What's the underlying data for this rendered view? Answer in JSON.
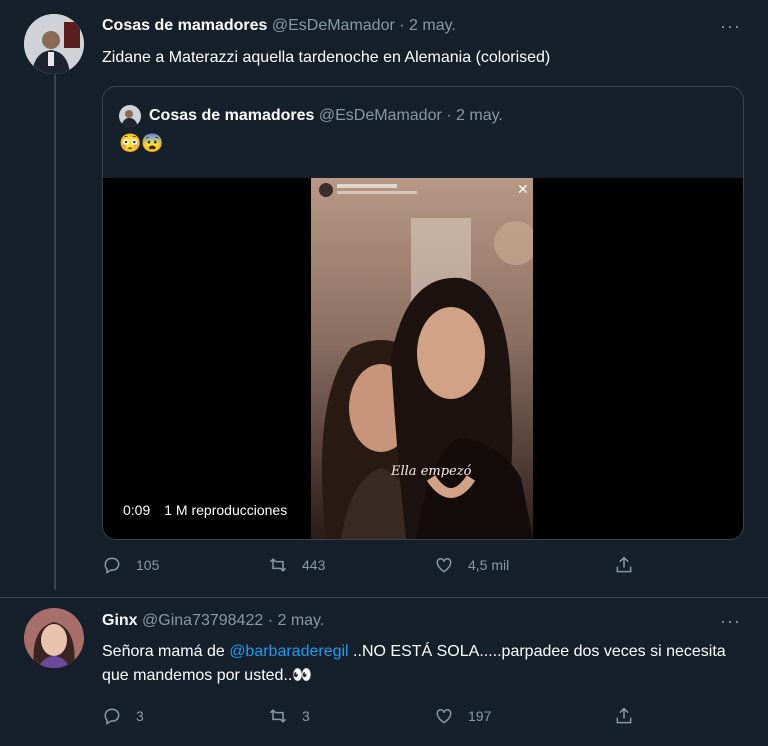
{
  "tweet1": {
    "display_name": "Cosas de mamadores",
    "handle": "@EsDeMamador",
    "date": "· 2 may.",
    "text": "Zidane a Materazzi aquella tardenoche en Alemania (colorised)",
    "more": "···",
    "quote": {
      "display_name": "Cosas de mamadores",
      "handle": "@EsDeMamador",
      "date": "· 2 may.",
      "text": "😳😨",
      "video": {
        "duration": "0:09",
        "views": "1 M reproducciones",
        "story_caption": "Ella empezó"
      }
    },
    "actions": {
      "replies": "105",
      "retweets": "443",
      "likes": "4,5 mil"
    }
  },
  "tweet2": {
    "display_name": "Ginx",
    "handle": "@Gina73798422",
    "date": "· 2 may.",
    "text_before": "Señora mamá de ",
    "mention": "@barbaraderegil",
    "text_after": " ..NO ESTÁ SOLA.....parpadee dos veces si necesita que mandemos por usted..👀",
    "more": "···",
    "actions": {
      "replies": "3",
      "retweets": "3",
      "likes": "197"
    }
  },
  "icons": [
    "reply-icon",
    "retweet-icon",
    "like-icon",
    "share-icon",
    "more-icon"
  ]
}
